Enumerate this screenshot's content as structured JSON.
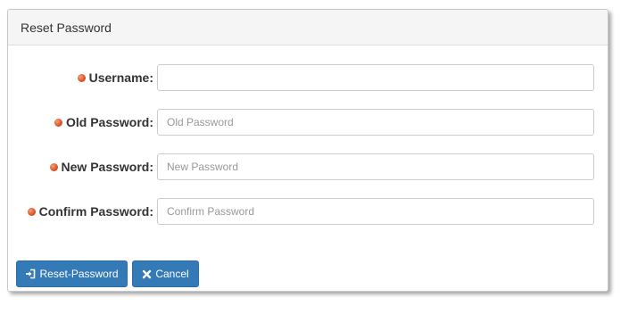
{
  "panel": {
    "title": "Reset Password"
  },
  "form": {
    "fields": [
      {
        "label": "Username:",
        "value": "",
        "placeholder": ""
      },
      {
        "label": "Old Password:",
        "value": "",
        "placeholder": "Old Password"
      },
      {
        "label": "New Password:",
        "value": "",
        "placeholder": "New Password"
      },
      {
        "label": "Confirm Password:",
        "value": "",
        "placeholder": "Confirm Password"
      }
    ]
  },
  "actions": {
    "reset_label": "Reset-Password",
    "reset_icon": "sign-in-icon",
    "cancel_label": "Cancel",
    "cancel_icon": "close-icon"
  },
  "colors": {
    "primary": "#337ab7",
    "required_marker": "#e0562a",
    "heading_bg": "#f5f5f5"
  }
}
